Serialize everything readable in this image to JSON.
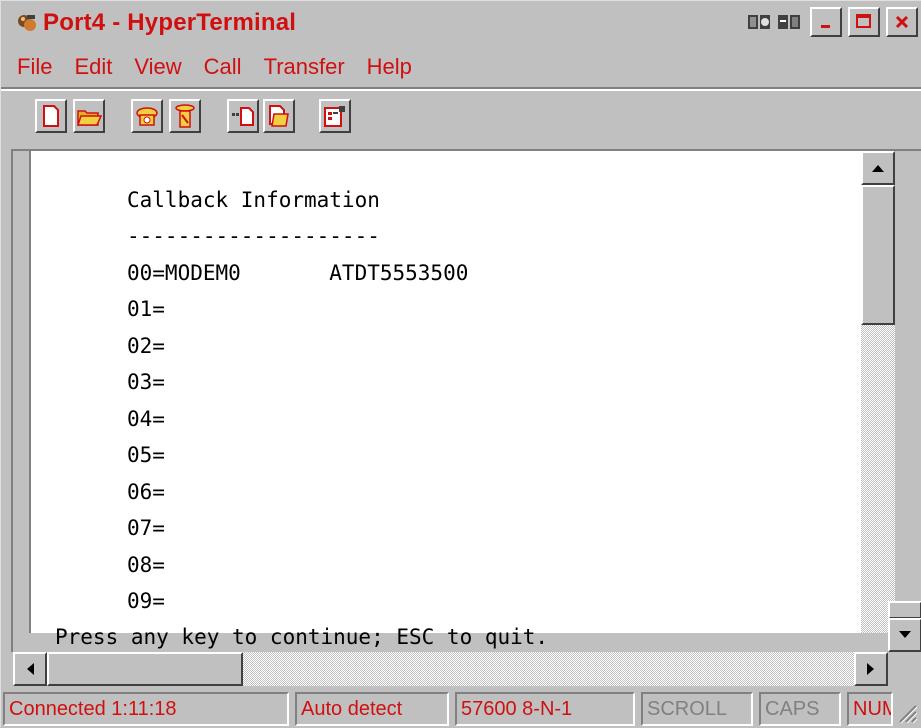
{
  "window": {
    "title": "Port4 - HyperTerminal"
  },
  "menu": {
    "items": [
      "File",
      "Edit",
      "View",
      "Call",
      "Transfer",
      "Help"
    ]
  },
  "toolbar": {
    "buttons": [
      "new-connection",
      "open",
      "connect",
      "disconnect",
      "send",
      "receive",
      "properties"
    ]
  },
  "terminal": {
    "lines": [
      "Callback Information",
      "--------------------",
      "00=MODEM0       ATDT5553500",
      "01=",
      "02=",
      "03=",
      "04=",
      "05=",
      "06=",
      "07=",
      "08=",
      "09="
    ],
    "prompt": "Press any key to continue; ESC to quit."
  },
  "status": {
    "connected": "Connected 1:11:18",
    "detect": "Auto detect",
    "settings": "57600 8-N-1",
    "scroll": "SCROLL",
    "caps": "CAPS",
    "num": "NUM"
  },
  "colors": {
    "accent_text": "#d01010",
    "face": "#c0c0c0"
  }
}
